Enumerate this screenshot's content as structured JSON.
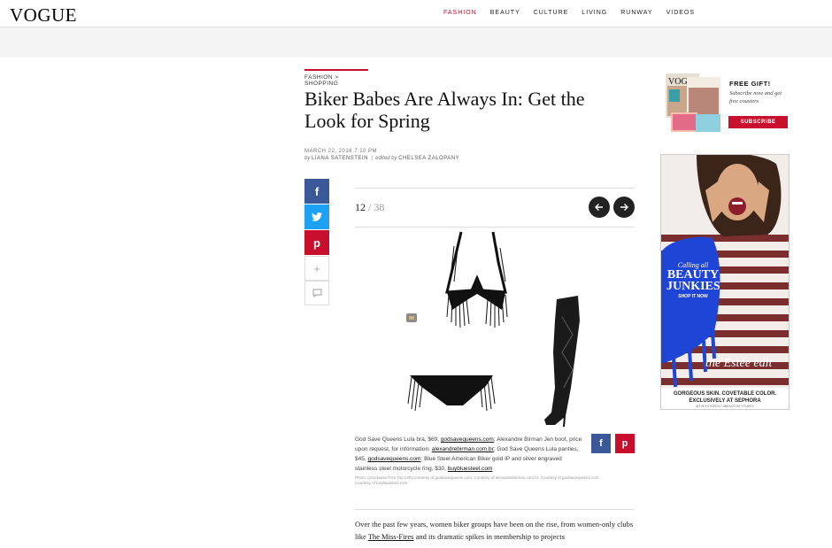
{
  "header": {
    "logo": "VOGUE",
    "nav": [
      "FASHION",
      "BEAUTY",
      "CULTURE",
      "LIVING",
      "RUNWAY",
      "VIDEOS"
    ],
    "active_nav": "FASHION"
  },
  "article": {
    "section": "FASHION > SHOPPING",
    "title": "Biker Babes Are Always In: Get the Look for Spring",
    "date": "MARCH 22, 2016 7:10 PM",
    "by_prefix": "by",
    "author": "LIANA SATENSTEIN",
    "separator": "|",
    "edited_prefix": "edited by",
    "editor": "CHELSEA ZALOPANY"
  },
  "share": {
    "facebook": "f",
    "twitter": "t",
    "pinterest": "p",
    "plus": "+",
    "comment_icon": "comment-icon"
  },
  "slideshow": {
    "current": "12",
    "separator": " / ",
    "total": "38",
    "prev_icon": "arrow-left-icon",
    "next_icon": "arrow-right-icon"
  },
  "caption": {
    "p1": "God Save Queens Lula bra, $69, ",
    "link1": "godsavequeens.com",
    "p2": "; Alexandre Birman Jen boot, price upon request, for information: ",
    "link2": "alexandrebirman.com.br",
    "p3": "; God Save Queens Lula panties, $45, ",
    "link3": "godsavequeens.com",
    "p4": "; Blue Steel American Biker gold IP and silver engraved stainless steel motorcycle ring, $30, ",
    "link4": "buybluesteel.com",
    "credit": "Photo: (Clockwise from Top Left) Courtesy of godsavequeens.com; Courtesy of alexandrebirman.com.br; Courtesy of godsavequeens.com; Courtesy of buybluesteel.com"
  },
  "body": {
    "p1": "Over the past few years, women biker groups have been on the rise, from women-only clubs like ",
    "link": "The Miss-Fires",
    "p2": " and its dramatic spikes in membership to projects"
  },
  "promo": {
    "title": "FREE GIFT!",
    "text": "Subscribe now and get free coasters",
    "button": "SUBSCRIBE",
    "magazine_logo": "VOGUE"
  },
  "ad": {
    "callout1": "Calling all",
    "callout2": "BEAUTY JUNKIES",
    "callout3": "SHOP IT NOW",
    "brand": "the Estée edit",
    "footer": "GORGEOUS SKIN. COVETABLE COLOR. EXCLUSIVELY AT SEPHORA",
    "tags": "@THEESTEEEDIT #BEAUTYATTITUDES"
  },
  "colors": {
    "accent": "#c8102e",
    "facebook": "#3b5998",
    "twitter": "#1da1f2"
  }
}
